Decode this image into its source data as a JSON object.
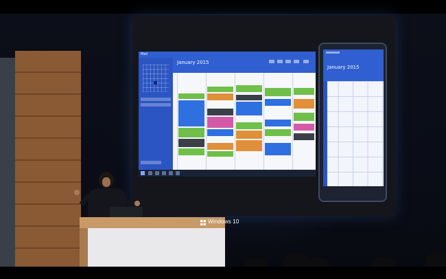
{
  "desktop_app": {
    "title": "Mail",
    "month": "January 2015"
  },
  "phone_app": {
    "month": "January 2015"
  },
  "podium": {
    "brand": "Windows 10"
  },
  "colors": {
    "calendar_blue": "#2f5fd0",
    "event_green": "#6fbf4a",
    "event_blue": "#2f6fe0",
    "event_orange": "#e0903a",
    "event_pink": "#d45aa8",
    "event_gray": "#3b3f48"
  }
}
